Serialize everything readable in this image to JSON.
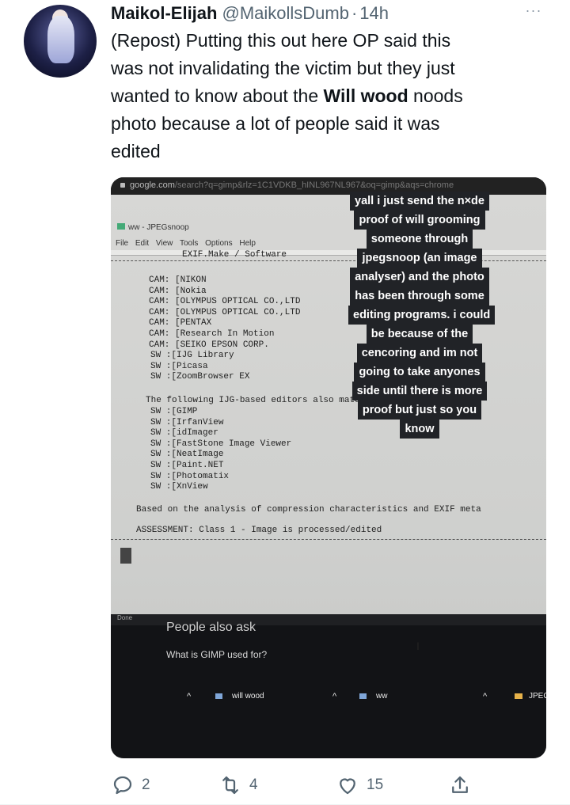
{
  "tweet": {
    "author_name": "Maikol-Elijah",
    "handle": "@MaikollsDumb",
    "separator": "·",
    "time": "14h",
    "more_label": "···",
    "text_lines": {
      "l1": "(Repost) Putting this out here OP said this",
      "l2": "was not invalidating the victim but they just",
      "l3_pre": "wanted to know about the ",
      "l3_bold": "Will wood",
      "l3_post": " noods",
      "l4": "photo because a lot of people said it was",
      "l5": "edited"
    }
  },
  "media": {
    "url_host": "google.com",
    "url_query": "/search?q=gimp&rlz=1C1VDKB_hINL967NL967&oq=gimp&aqs=chrome",
    "window_title": "ww - JPEGsnoop",
    "menu": "File  Edit  View  Tools  Options  Help",
    "console_header": "EXIF.Make / Software",
    "cam_lines": [
      "CAM: [NIKON",
      "CAM: [Nokia",
      "CAM: [OLYMPUS OPTICAL CO.,LTD",
      "CAM: [OLYMPUS OPTICAL CO.,LTD",
      "CAM: [PENTAX",
      "CAM: [Research In Motion",
      "CAM: [SEIKO EPSON CORP.",
      "SW :[IJG Library",
      "SW :[Picasa",
      "SW :[ZoomBrowser EX"
    ],
    "editors_heading": "The following IJG-based editors also match this signature:",
    "sw_lines": [
      "SW :[GIMP",
      "SW :[IrfanView",
      "SW :[idImager",
      "SW :[FastStone Image Viewer",
      "SW :[NeatImage",
      "SW :[Paint.NET",
      "SW :[Photomatix",
      "SW :[XnView"
    ],
    "analysis_line": "Based on the analysis of compression characteristics and EXIF meta",
    "assessment_line": "ASSESSMENT: Class 1 - Image is processed/edited",
    "status_text": "Done",
    "people_also_ask": "People also ask",
    "paa_question": "What is GIMP used for?",
    "taskbar": {
      "item1": "will wood",
      "item2": "ww",
      "item3": "JPEG",
      "chevron": "^"
    },
    "cursor_glyph": "I",
    "overlay_lines": [
      "yall i just send the n×de",
      "proof of will grooming",
      "someone through",
      "jpegsnoop (an image",
      "analyser) and the photo",
      "has been through some",
      "editing programs. i could",
      "be because of the",
      "cencoring and im not",
      "going to take anyones",
      "side until there is more",
      "proof but just so you",
      "know"
    ]
  },
  "actions": {
    "reply_count": "2",
    "retweet_count": "4",
    "like_count": "15"
  },
  "icons": {
    "reply": "reply-icon",
    "retweet": "retweet-icon",
    "like": "heart-icon",
    "share": "share-icon"
  },
  "colors": {
    "text": "#0f1419",
    "secondary": "#536471"
  }
}
